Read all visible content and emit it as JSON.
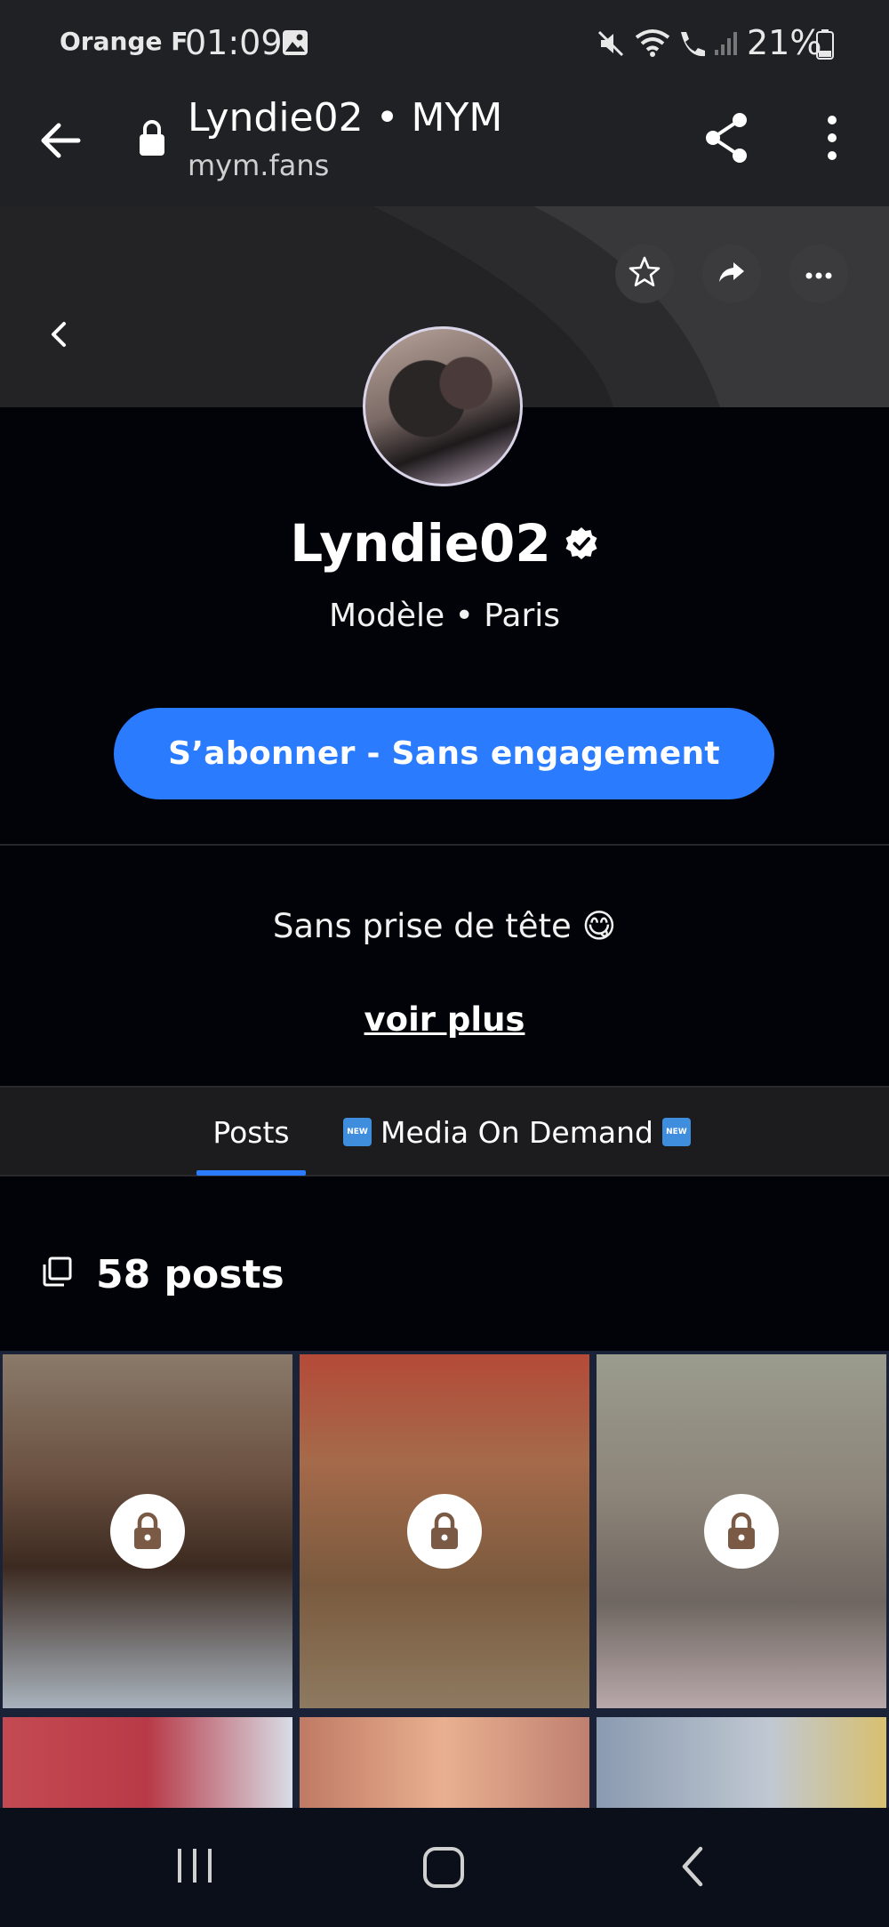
{
  "status_bar": {
    "carrier": "Orange F",
    "time": "01:09",
    "battery": "21%"
  },
  "browser": {
    "title": "Lyndie02 • MYM",
    "url": "mym.fans"
  },
  "profile": {
    "name": "Lyndie02",
    "subtitle": "Modèle • Paris",
    "subscribe_label": "S’abonner - Sans engagement",
    "bio": "Sans prise de tête 😋",
    "see_more": "voir plus"
  },
  "tabs": [
    {
      "label": "Posts",
      "active": true
    },
    {
      "label": "Media On Demand",
      "active": false
    }
  ],
  "new_badge": "NEW",
  "posts": {
    "count_label": "58 posts"
  },
  "colors": {
    "accent": "#2b7bff",
    "background": "#020308",
    "bar": "#202124"
  }
}
